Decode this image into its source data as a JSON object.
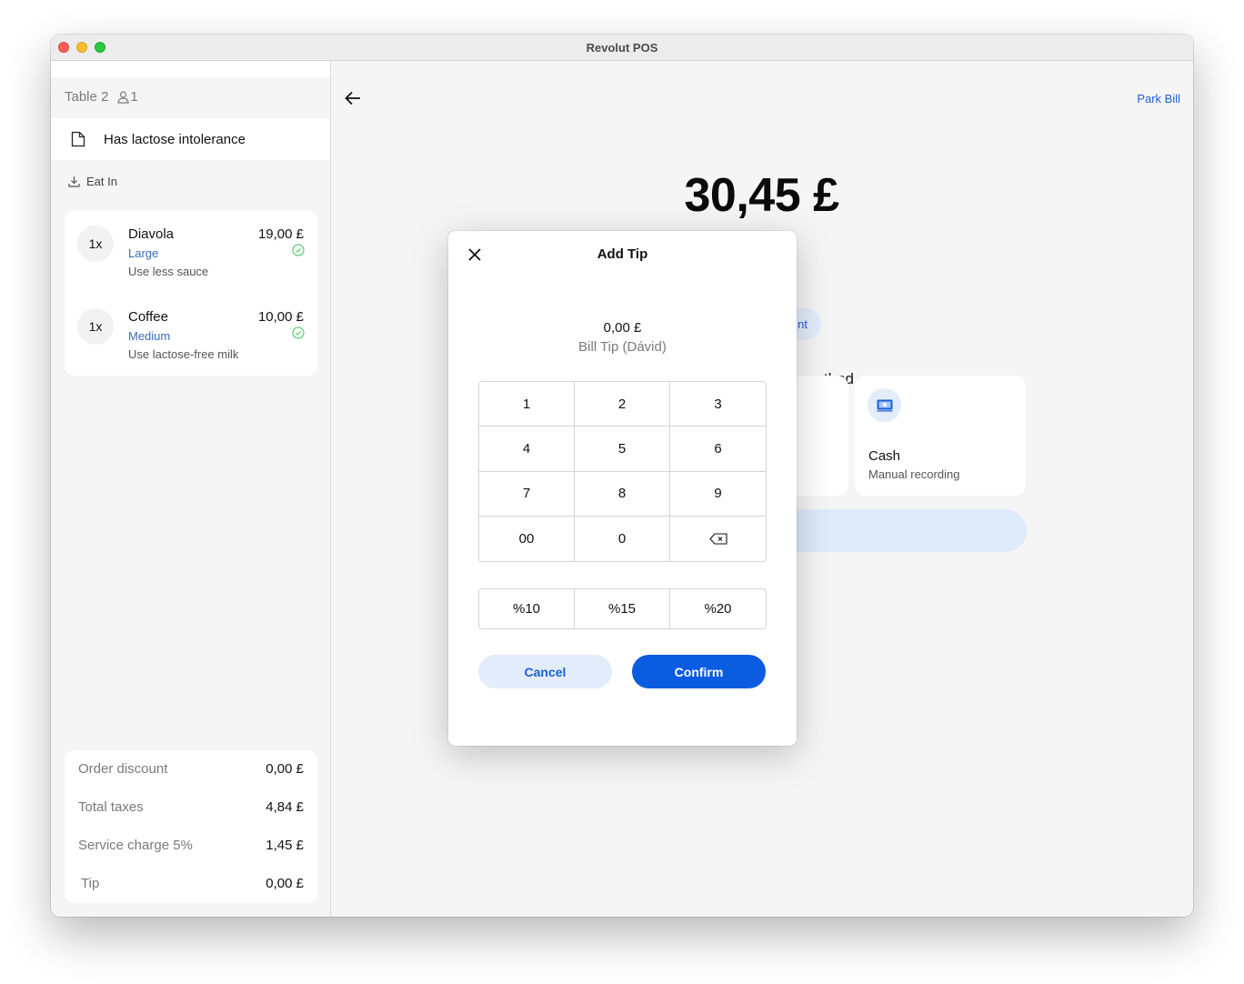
{
  "window": {
    "title": "Revolut POS"
  },
  "sidebar": {
    "table_label": "Table 2",
    "guest_count": "1",
    "note": "Has lactose intolerance",
    "order_type": "Eat In",
    "items": [
      {
        "qty": "1x",
        "name": "Diavola",
        "variant": "Large",
        "note": "Use less sauce",
        "price": "19,00 £",
        "status": "sent"
      },
      {
        "qty": "1x",
        "name": "Coffee",
        "variant": "Medium",
        "note": "Use lactose-free milk",
        "price": "10,00 £",
        "status": "sent"
      }
    ],
    "summary": [
      {
        "label": "Order discount",
        "value": "0,00 £"
      },
      {
        "label": "Total taxes",
        "value": "4,84 £"
      },
      {
        "label": "Service charge 5%",
        "value": "1,45 £"
      },
      {
        "label": "Tip",
        "value": "0,00 £"
      }
    ]
  },
  "main": {
    "park_bill_label": "Park Bill",
    "total_amount": "30,45 £",
    "split_pill_partial": "nt",
    "method_title_partial": "method",
    "cash_method": {
      "title": "Cash",
      "subtitle": "Manual recording"
    }
  },
  "modal": {
    "title": "Add Tip",
    "tip_amount": "0,00 £",
    "tip_label": "Bill Tip (Dávid)",
    "keys": [
      "1",
      "2",
      "3",
      "4",
      "5",
      "6",
      "7",
      "8",
      "9",
      "00",
      "0",
      "backspace"
    ],
    "percent_options": [
      "%10",
      "%15",
      "%20"
    ],
    "cancel_label": "Cancel",
    "confirm_label": "Confirm"
  },
  "colors": {
    "accent": "#0b5ce0",
    "accent_light": "#e3ecfb",
    "variant_text": "#3b6bb0",
    "check_green": "#34c759"
  }
}
